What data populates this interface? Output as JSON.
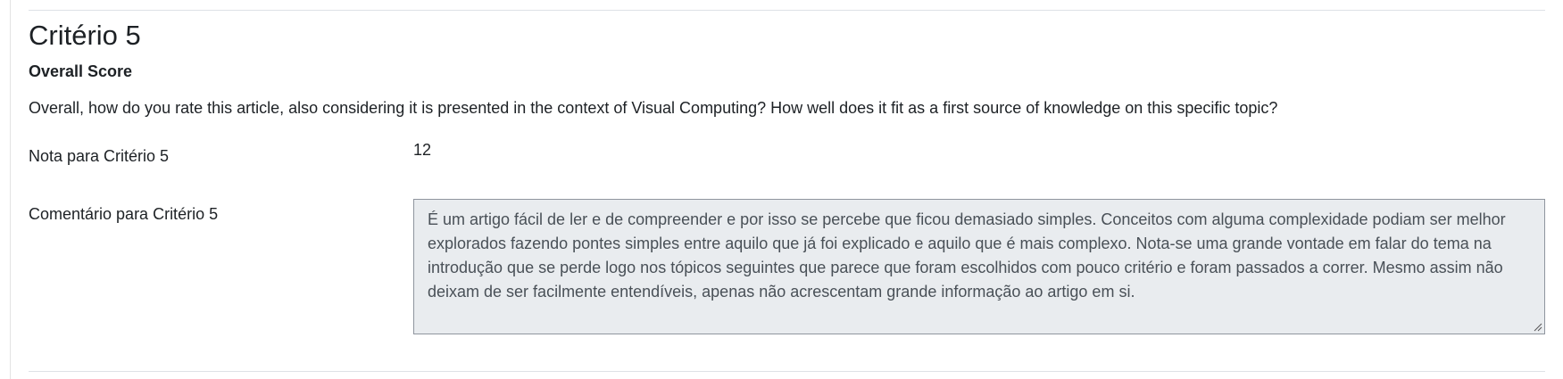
{
  "criterion": {
    "title": "Critério 5",
    "subtitle": "Overall Score",
    "description": "Overall, how do you rate this article, also considering it is presented in the context of Visual Computing? How well does it fit as a first source of knowledge on this specific topic?"
  },
  "grade": {
    "label": "Nota para Critério 5",
    "value": "12"
  },
  "comment": {
    "label": "Comentário para Critério 5",
    "text": "É um artigo fácil de ler e de compreender e por isso se percebe que ficou demasiado simples. Conceitos com alguma complexidade podiam ser melhor explorados fazendo pontes simples entre aquilo que já foi explicado e aquilo que é mais complexo. Nota-se uma grande vontade em falar do tema na introdução que se perde logo nos tópicos seguintes que parece que foram escolhidos com pouco critério e foram passados a correr. Mesmo assim não deixam de ser facilmente entendíveis, apenas não acrescentam grande informação ao artigo em si.",
    "resize_icon": "resize-grip-icon"
  }
}
